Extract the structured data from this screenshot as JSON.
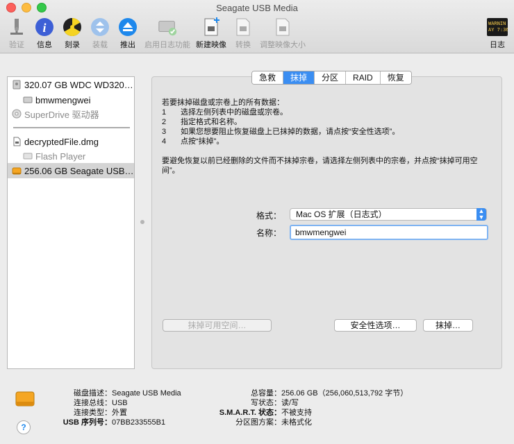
{
  "window": {
    "title": "Seagate USB Media"
  },
  "toolbar": {
    "items": [
      {
        "label": "验证",
        "icon": "microscope-icon",
        "disabled": true
      },
      {
        "label": "信息",
        "icon": "info-icon"
      },
      {
        "label": "刻录",
        "icon": "burn-icon"
      },
      {
        "label": "装载",
        "icon": "mount-icon",
        "disabled": true
      },
      {
        "label": "推出",
        "icon": "eject-icon"
      },
      {
        "label": "启用日志功能",
        "icon": "journaling-icon",
        "disabled": true
      },
      {
        "label": "新建映像",
        "icon": "new-image-icon"
      },
      {
        "label": "转换",
        "icon": "convert-icon",
        "disabled": true
      },
      {
        "label": "调整映像大小",
        "icon": "resize-image-icon",
        "disabled": true
      }
    ],
    "log": {
      "label": "日志",
      "icon_text_1": "WARNIN",
      "icon_text_2": "AY 7:36"
    }
  },
  "sidebar": {
    "items": [
      {
        "label": "320.07 GB WDC WD320…",
        "icon": "hard-drive-icon"
      },
      {
        "label": "bmwmengwei",
        "icon": "volume-icon"
      },
      {
        "label": "SuperDrive 驱动器",
        "icon": "optical-drive-icon",
        "dim": true
      },
      {
        "label": "decryptedFile.dmg",
        "icon": "disk-image-icon"
      },
      {
        "label": "Flash Player",
        "icon": "volume-icon",
        "dim": true
      },
      {
        "label": "256.06 GB Seagate USB…",
        "icon": "external-drive-icon",
        "selected": true
      }
    ]
  },
  "tabs": [
    {
      "label": "急救"
    },
    {
      "label": "抹掉",
      "active": true
    },
    {
      "label": "分区"
    },
    {
      "label": "RAID"
    },
    {
      "label": "恢复"
    }
  ],
  "erase": {
    "intro": "若要抹掉磁盘或宗卷上的所有数据：",
    "steps": [
      {
        "num": "1",
        "text": "选择左侧列表中的磁盘或宗卷。"
      },
      {
        "num": "2",
        "text": "指定格式和名称。"
      },
      {
        "num": "3",
        "text": "如果您想要阻止恢复磁盘上已抹掉的数据，请点按“安全性选项”。"
      },
      {
        "num": "4",
        "text": "点按“抹掉”。"
      }
    ],
    "note": "要避免恢复以前已经删除的文件而不抹掉宗卷，请选择左侧列表中的宗卷，并点按“抹掉可用空间”。",
    "format_label": "格式：",
    "format_value": "Mac OS 扩展（日志式）",
    "name_label": "名称：",
    "name_value": "bmwmengwei",
    "erase_free_space_button": "抹掉可用空间…",
    "security_options_button": "安全性选项…",
    "erase_button": "抹掉…"
  },
  "details": {
    "left": [
      {
        "k": "磁盘描述：",
        "v": "Seagate USB Media"
      },
      {
        "k": "连接总线：",
        "v": "USB"
      },
      {
        "k": "连接类型：",
        "v": "外置"
      },
      {
        "k": "USB 序列号：",
        "v": "07BB233555B1",
        "bold_key": true
      }
    ],
    "right": [
      {
        "k": "总容量：",
        "v": "256.06 GB（256,060,513,792 字节）"
      },
      {
        "k": "写状态：",
        "v": "读/写"
      },
      {
        "k": "S.M.A.R.T. 状态：",
        "v": "不被支持",
        "bold_key": true
      },
      {
        "k": "分区图方案：",
        "v": "未格式化"
      }
    ]
  },
  "help": {
    "label": "?"
  },
  "colors": {
    "accent": "#3b8ef2",
    "selected_row": "#d4d4d4"
  }
}
